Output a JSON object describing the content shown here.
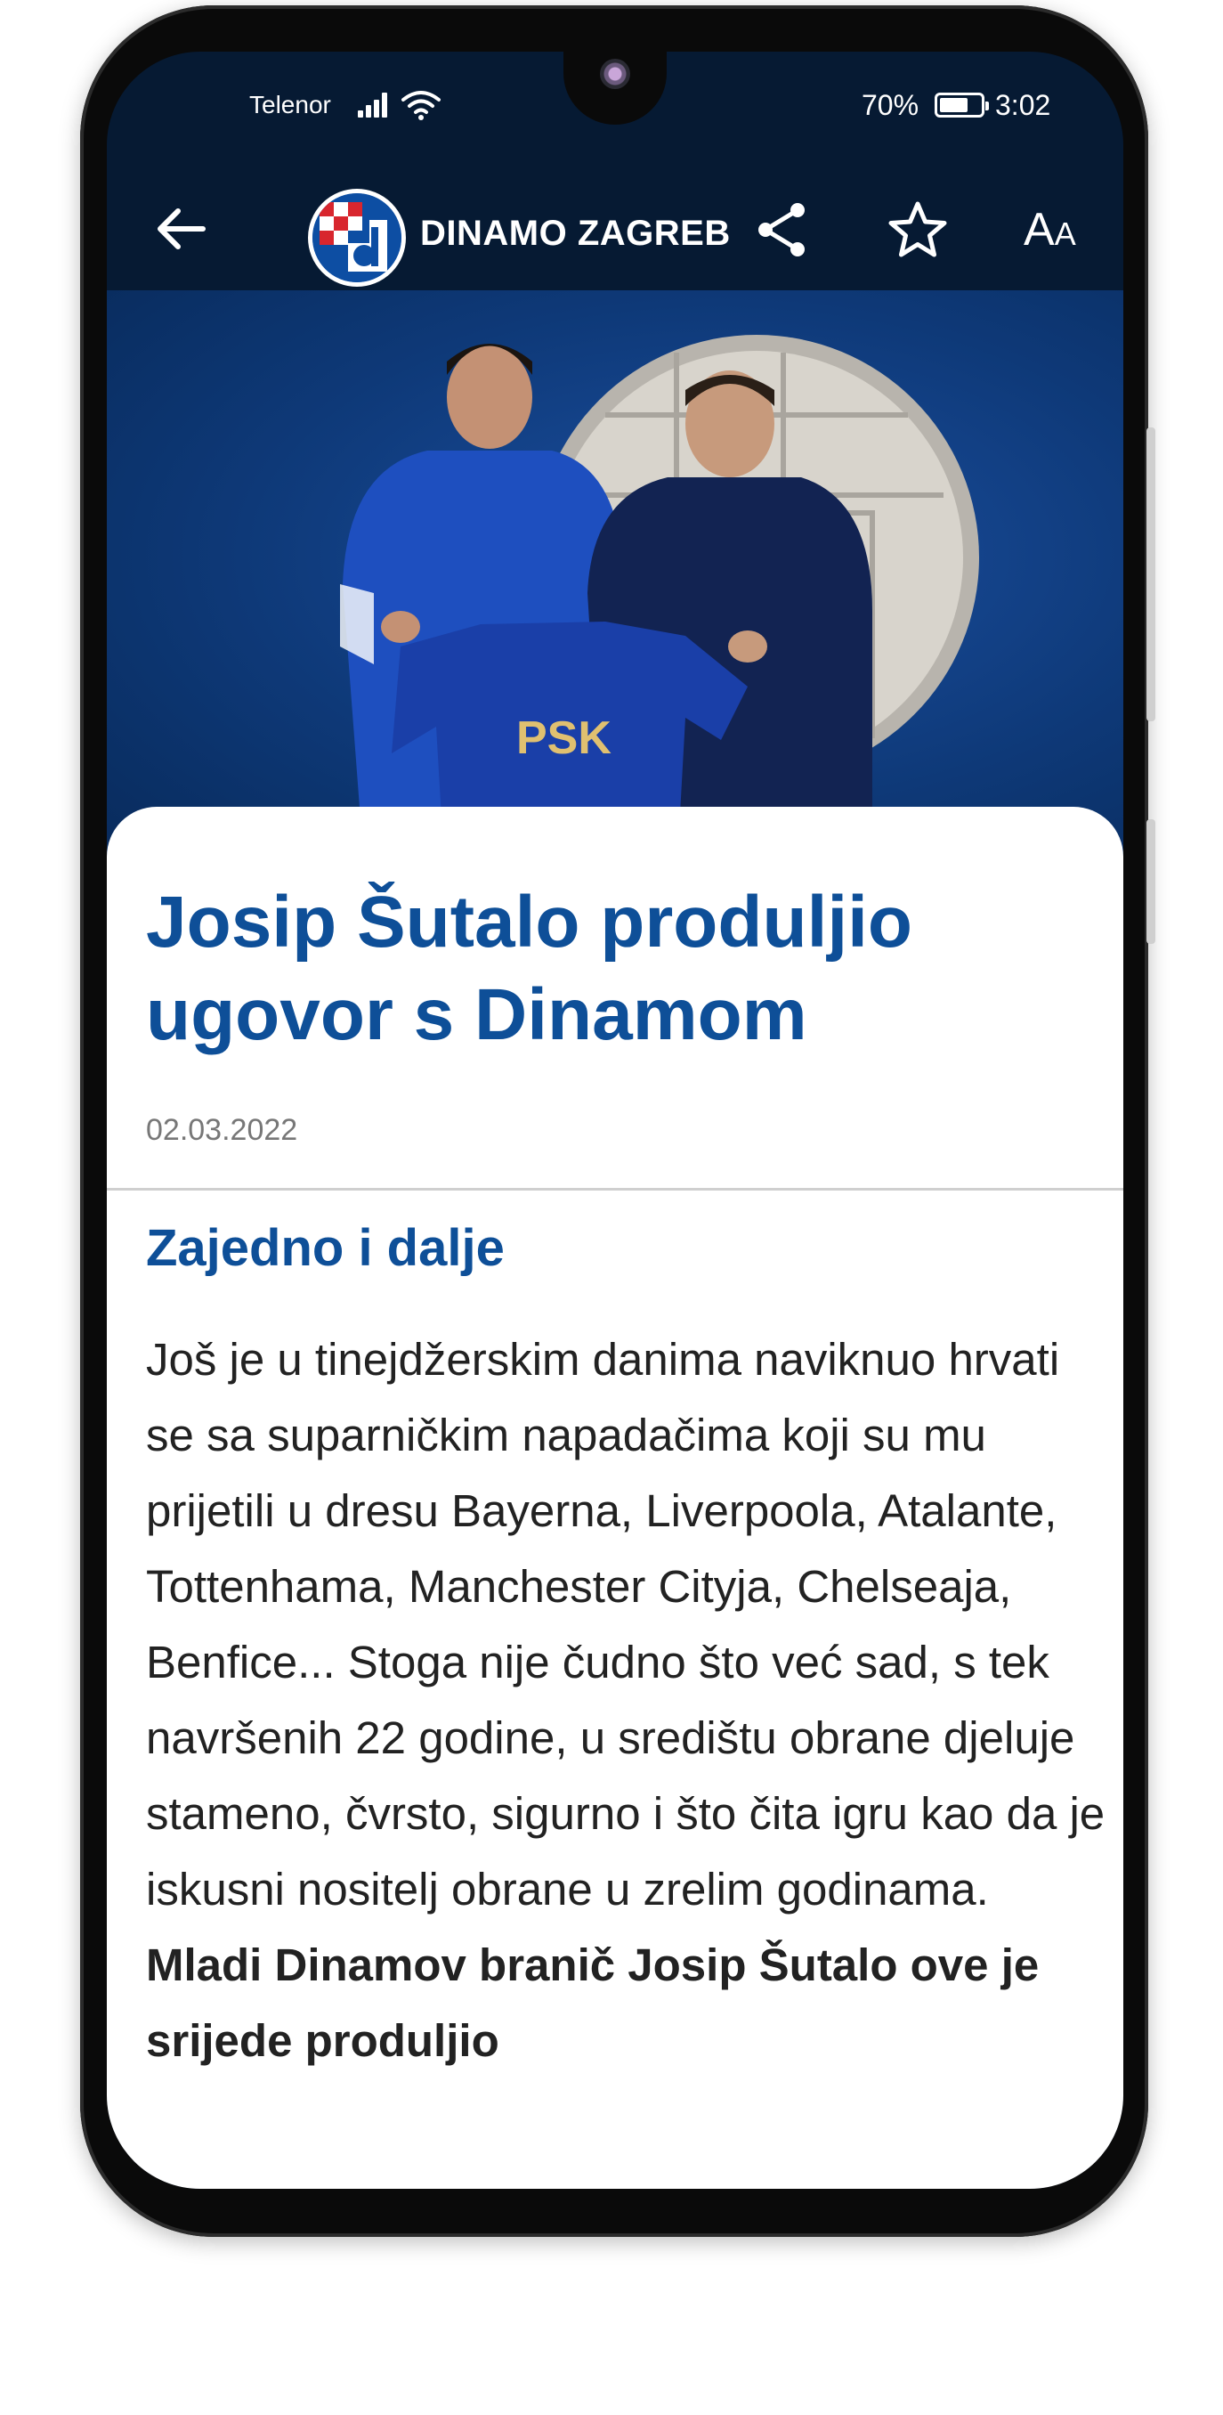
{
  "status_bar": {
    "carrier": "Telenor",
    "battery": "70%",
    "battery_level": 0.7,
    "time": "3:02"
  },
  "app_bar": {
    "brand": "DINAMO ZAGREB",
    "font_size_big": "A",
    "font_size_small": "A"
  },
  "article": {
    "title": "Josip Šutalo produljio ugovor s Dinamom",
    "date": "02.03.2022",
    "subheading": "Zajedno i dalje",
    "body": "Još je u tinejdžerskim danima naviknuo hrvati se sa suparničkim napadačima koji su mu prijetili u dresu Bayerna, Liverpoola, Atalante, Tottenhama, Manchester Cityja, Chelseaja, Benfice... Stoga nije čudno što već sad, s tek navršenih 22 godine, u središtu obrane djeluje stameno, čvrsto, sigurno i što čita igru kao da je iskusni nositelj obrane u zrelim godinama.",
    "body_bold": "Mladi Dinamov branič Josip Šutalo ove je srijede produljio"
  },
  "hero_image": {
    "jersey_sponsor": "PSK"
  },
  "colors": {
    "header_bg": "#061a33",
    "accent": "#0e4f98",
    "text": "#222222",
    "date": "#777777"
  },
  "icons": [
    "back-arrow-icon",
    "club-logo",
    "share-icon",
    "star-icon",
    "font-size-icon",
    "signal-icon",
    "wifi-icon",
    "battery-icon"
  ]
}
